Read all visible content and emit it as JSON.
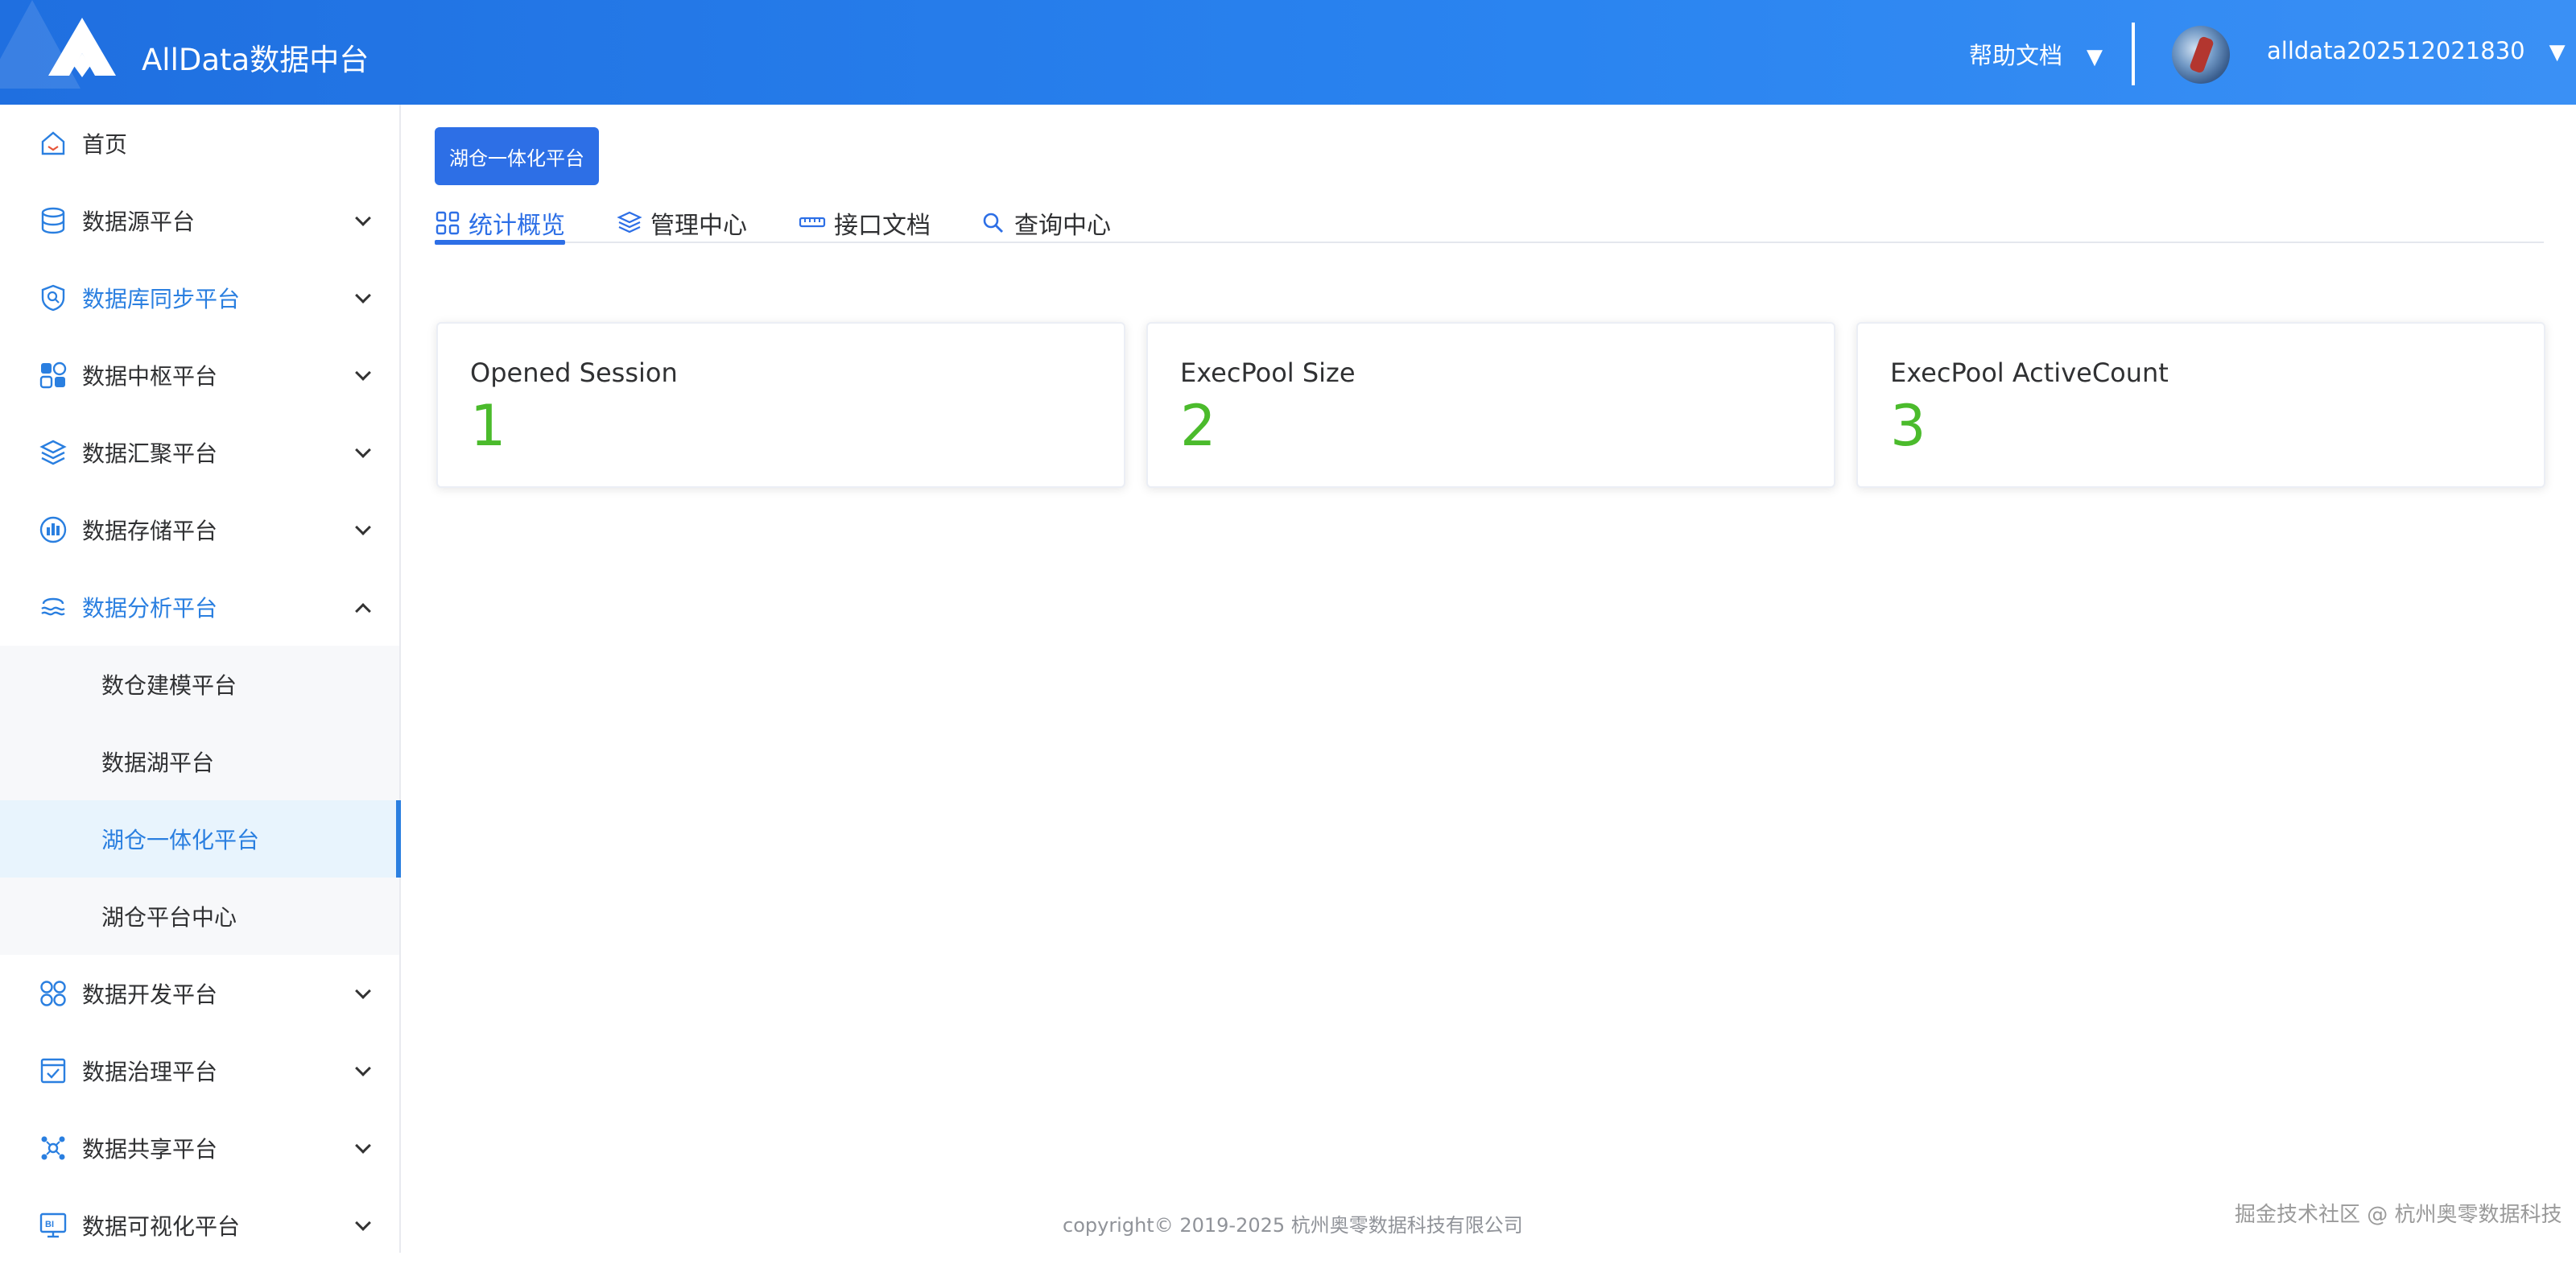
{
  "header": {
    "app_title": "AllData数据中台",
    "help_label": "帮助文档",
    "username": "alldata202512021830",
    "caret": "▼"
  },
  "sidebar": {
    "items": [
      {
        "label": "首页",
        "icon": "home-icon",
        "has_children": false
      },
      {
        "label": "数据源平台",
        "icon": "database-icon",
        "has_children": true
      },
      {
        "label": "数据库同步平台",
        "icon": "sync-shield-icon",
        "has_children": true,
        "highlight": true
      },
      {
        "label": "数据中枢平台",
        "icon": "grid-blocks-icon",
        "has_children": true
      },
      {
        "label": "数据汇聚平台",
        "icon": "layers-icon",
        "has_children": true
      },
      {
        "label": "数据存储平台",
        "icon": "bar-chart-circle-icon",
        "has_children": true
      },
      {
        "label": "数据分析平台",
        "icon": "analysis-waves-icon",
        "has_children": true,
        "expanded": true,
        "highlight": true
      }
    ],
    "submenu": [
      {
        "label": "数仓建模平台"
      },
      {
        "label": "数据湖平台"
      },
      {
        "label": "湖仓一体化平台",
        "selected": true
      },
      {
        "label": "湖仓平台中心"
      }
    ],
    "items_after": [
      {
        "label": "数据开发平台",
        "icon": "four-circles-icon"
      },
      {
        "label": "数据治理平台",
        "icon": "checklist-icon"
      },
      {
        "label": "数据共享平台",
        "icon": "network-share-icon"
      },
      {
        "label": "数据可视化平台",
        "icon": "bi-monitor-icon"
      }
    ]
  },
  "main": {
    "tag_button": "湖仓一体化平台",
    "tabs": [
      {
        "label": "统计概览",
        "icon": "grid-squares-icon",
        "active": true
      },
      {
        "label": "管理中心",
        "icon": "layers-icon"
      },
      {
        "label": "接口文档",
        "icon": "ruler-icon"
      },
      {
        "label": "查询中心",
        "icon": "search-icon"
      }
    ],
    "cards": [
      {
        "label": "Opened Session",
        "value": "1"
      },
      {
        "label": "ExecPool Size",
        "value": "2"
      },
      {
        "label": "ExecPool ActiveCount",
        "value": "3"
      }
    ]
  },
  "footer": {
    "copyright": "copyright© 2019-2025 杭州奥零数据科技有限公司",
    "watermark": "掘金技术社区 @ 杭州奥零数据科技"
  },
  "colors": {
    "header_start": "#1f6fe0",
    "header_end": "#3a90f5",
    "accent": "#2d6fe6",
    "metric_green": "#4bbb2c",
    "submenu_bg": "#f7f8fa",
    "selected_bg": "#e8f4fd"
  }
}
